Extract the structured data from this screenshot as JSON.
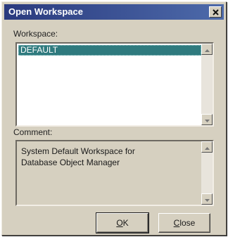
{
  "window": {
    "title": "Open Workspace",
    "close_icon": "close-x-icon"
  },
  "workspace": {
    "label": "Workspace:",
    "items": [
      "DEFAULT"
    ],
    "selected_index": 0
  },
  "comment": {
    "label": "Comment:",
    "text": "System Default Workspace for\nDatabase Object Manager"
  },
  "buttons": {
    "ok": {
      "accel": "O",
      "rest": "K"
    },
    "close": {
      "accel": "C",
      "rest": "lose"
    }
  },
  "colors": {
    "titlebar_start": "#2a3a7e",
    "titlebar_end": "#4d6aaa",
    "selection": "#2f7a7e",
    "dialog_bg": "#d6d0c0"
  }
}
